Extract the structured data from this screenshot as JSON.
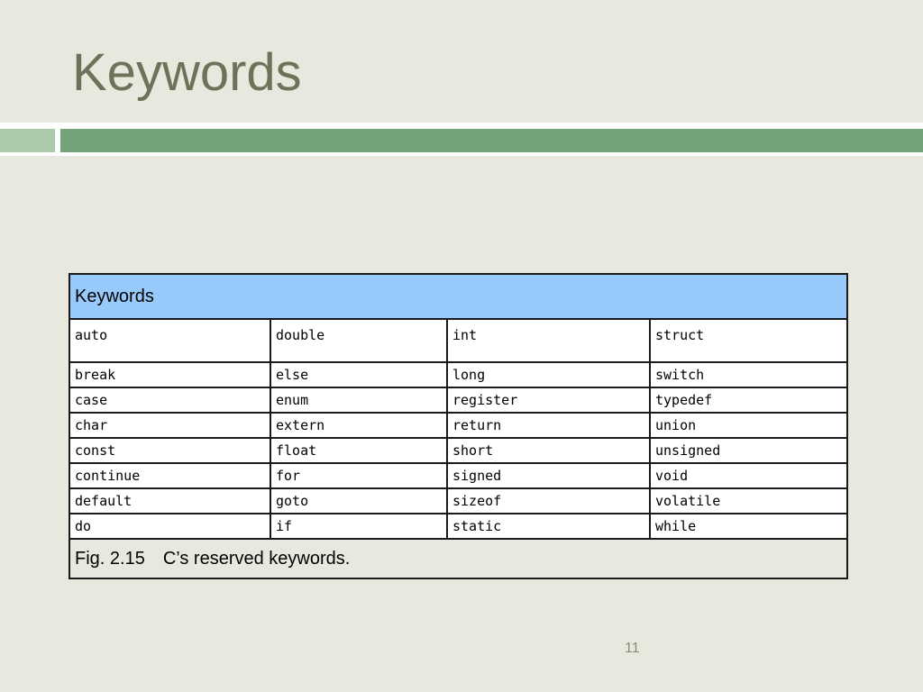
{
  "slide": {
    "title": "Keywords",
    "page_number": "11"
  },
  "colors": {
    "background": "#e9e8df",
    "title": "#6e7259",
    "band_light": "#aacaa9",
    "band_dark": "#73a37a",
    "table_header": "#97c9fb"
  },
  "table": {
    "header": "Keywords",
    "rows": [
      [
        "auto",
        "double",
        "int",
        "struct"
      ],
      [
        "break",
        "else",
        "long",
        "switch"
      ],
      [
        "case",
        "enum",
        "register",
        "typedef"
      ],
      [
        "char",
        "extern",
        "return",
        "union"
      ],
      [
        "const",
        "float",
        "short",
        "unsigned"
      ],
      [
        "continue",
        "for",
        "signed",
        "void"
      ],
      [
        "default",
        "goto",
        "sizeof",
        "volatile"
      ],
      [
        "do",
        "if",
        "static",
        "while"
      ]
    ],
    "caption": {
      "figure": "Fig. 2.15",
      "text": "C’s reserved keywords."
    }
  }
}
